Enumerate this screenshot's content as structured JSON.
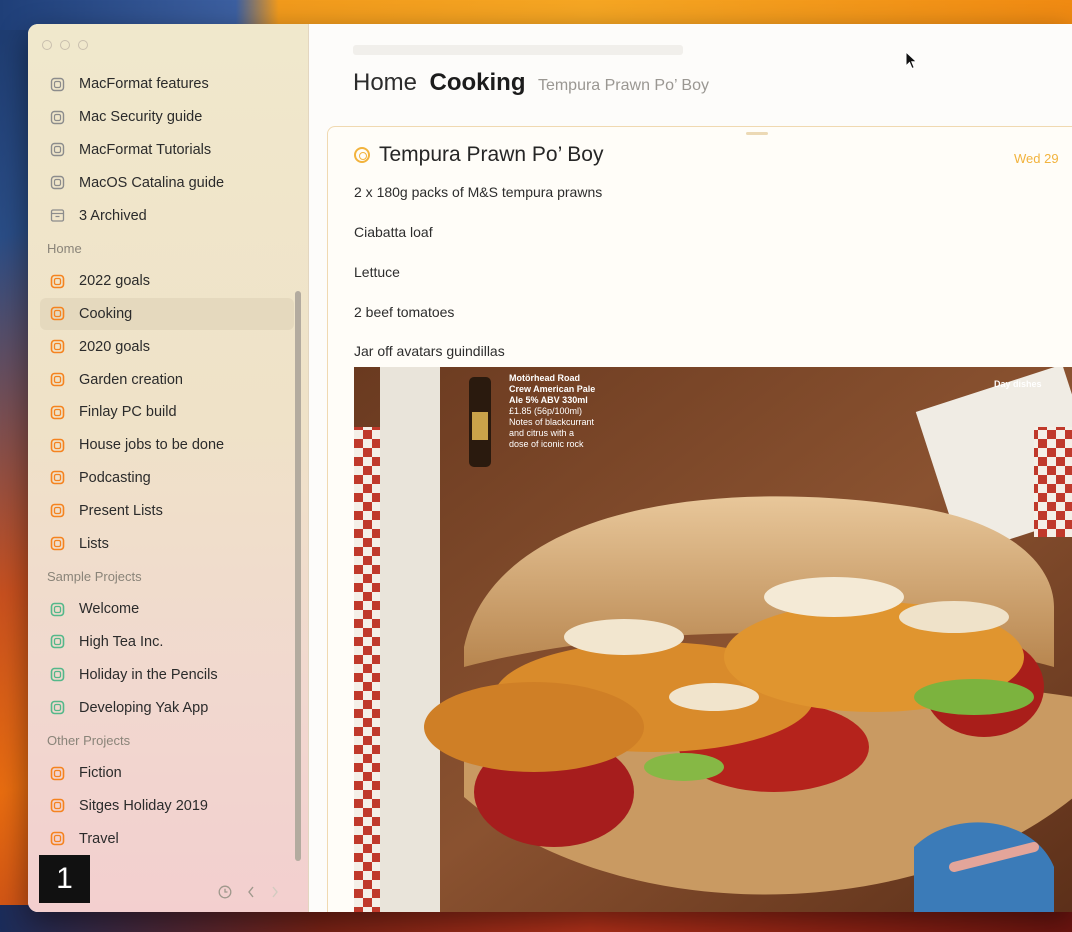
{
  "sidebar": {
    "top_items": [
      {
        "label": "MacFormat features"
      },
      {
        "label": "Mac Security guide"
      },
      {
        "label": "MacFormat Tutorials"
      },
      {
        "label": "MacOS Catalina guide"
      },
      {
        "label": "3 Archived"
      }
    ],
    "sections": [
      {
        "title": "Home",
        "items": [
          {
            "label": "2022 goals"
          },
          {
            "label": "Cooking"
          },
          {
            "label": "2020 goals"
          },
          {
            "label": "Garden creation"
          },
          {
            "label": "Finlay PC build"
          },
          {
            "label": "House jobs to be done"
          },
          {
            "label": "Podcasting"
          },
          {
            "label": "Present Lists"
          },
          {
            "label": "Lists"
          }
        ]
      },
      {
        "title": "Sample Projects",
        "items": [
          {
            "label": "Welcome"
          },
          {
            "label": "High Tea Inc."
          },
          {
            "label": "Holiday in the Pencils"
          },
          {
            "label": "Developing Yak App"
          }
        ]
      },
      {
        "title": "Other Projects",
        "items": [
          {
            "label": "Fiction"
          },
          {
            "label": "Sitges Holiday 2019"
          },
          {
            "label": "Travel"
          }
        ]
      }
    ],
    "active_item": "Cooking",
    "footer": {
      "history_icon": "clock-icon",
      "back_icon": "chevron-left-icon",
      "forward_icon": "chevron-right-icon"
    }
  },
  "badge": {
    "label": "1"
  },
  "header": {
    "crumb": "Home",
    "section": "Cooking",
    "subtitle": "Tempura Prawn Po’ Boy"
  },
  "note": {
    "title": "Tempura Prawn Po’ Boy",
    "date": "Wed 29",
    "lines": [
      "2 x 180g packs of M&S tempura prawns",
      "Ciabatta loaf",
      "Lettuce",
      "2 beef tomatoes",
      "Jar off avatars guindillas"
    ],
    "image_text": {
      "beer": "Motörhead Road Crew American Pale Ale 5% ABV 330ml £1.85 (56p/100ml) Notes of blackcurrant and citrus with a dose of iconic rock",
      "corner": "Day dishes"
    }
  },
  "colors": {
    "orange": "#f5831f",
    "blue": "#1f3f78",
    "green": "#54b88a",
    "project_orange": "#f5831f",
    "archive_gray": "#8c8c8c",
    "accent": "#f2b33d"
  }
}
